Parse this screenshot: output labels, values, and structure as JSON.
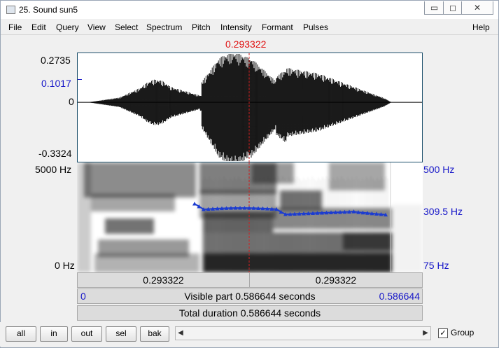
{
  "window": {
    "title": "25. Sound sun5",
    "minimize": "▭",
    "maximize": "◻",
    "close": "✕"
  },
  "menu": [
    "File",
    "Edit",
    "Query",
    "View",
    "Select",
    "Spectrum",
    "Pitch",
    "Intensity",
    "Formant",
    "Pulses",
    "Help"
  ],
  "cursor_time": "0.293322",
  "waveform": {
    "max": "0.2735",
    "cursor_value": "0.1017",
    "zero": "0",
    "min": "-0.3324"
  },
  "spectrogram": {
    "freq_top": "5000 Hz",
    "freq_bottom": "0 Hz"
  },
  "pitch": {
    "top": "500 Hz",
    "cursor": "309.5 Hz",
    "bottom": "75 Hz",
    "line_color": "#1c3cd0"
  },
  "bars": {
    "left_segment": "0.293322",
    "right_segment": "0.293322",
    "visible_start": "0",
    "visible_label": "Visible part 0.586644 seconds",
    "visible_end": "0.586644",
    "total_label": "Total duration 0.586644 seconds"
  },
  "buttons": {
    "all": "all",
    "in": "in",
    "out": "out",
    "sel": "sel",
    "bak": "bak"
  },
  "group": {
    "label": "Group",
    "checked": "✓"
  }
}
